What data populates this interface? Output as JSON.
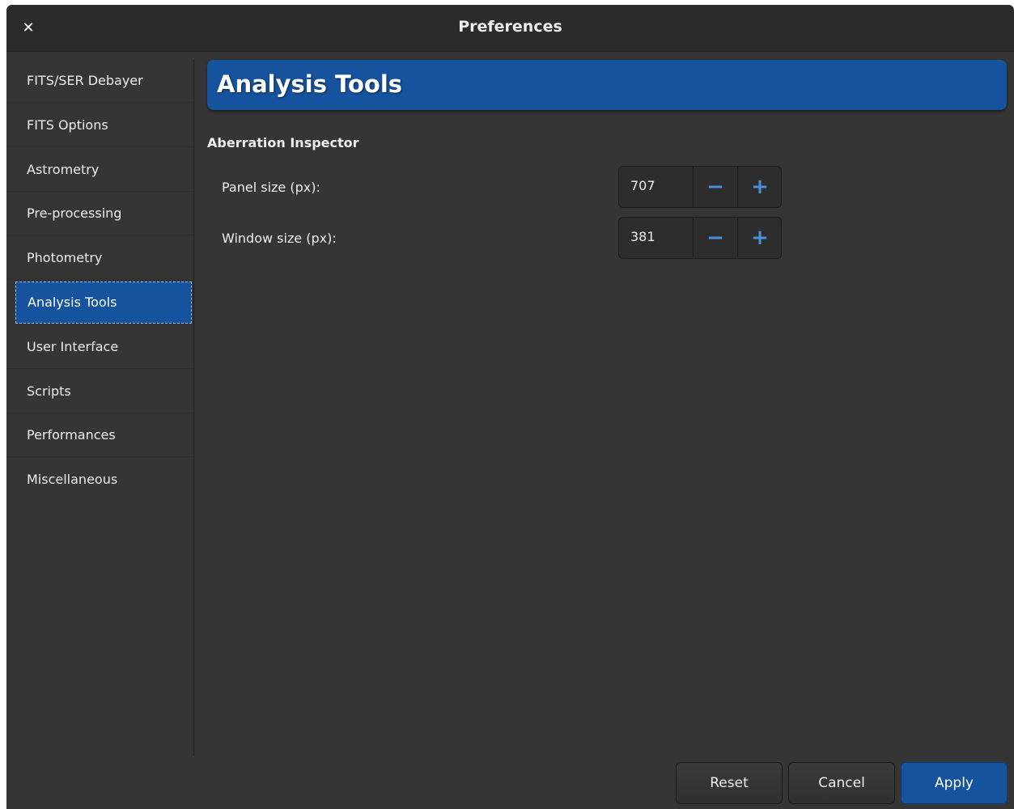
{
  "window": {
    "title": "Preferences",
    "close_icon": "close-icon"
  },
  "sidebar": {
    "items": [
      {
        "label": "FITS/SER Debayer"
      },
      {
        "label": "FITS Options"
      },
      {
        "label": "Astrometry"
      },
      {
        "label": "Pre-processing"
      },
      {
        "label": "Photometry"
      },
      {
        "label": "Analysis Tools",
        "selected": true
      },
      {
        "label": "User Interface"
      },
      {
        "label": "Scripts"
      },
      {
        "label": "Performances"
      },
      {
        "label": "Miscellaneous"
      }
    ]
  },
  "page": {
    "header": "Analysis Tools",
    "section": "Aberration Inspector",
    "fields": [
      {
        "label": "Panel size (px):",
        "value": "707"
      },
      {
        "label": "Window size (px):",
        "value": "381"
      }
    ],
    "minus_glyph": "−",
    "plus_glyph": "+"
  },
  "buttons": {
    "reset": "Reset",
    "cancel": "Cancel",
    "apply": "Apply"
  },
  "colors": {
    "accent": "#15539e",
    "background": "#353535",
    "titlebar": "#2b2b2b",
    "spin_icon": "#4a90d9"
  }
}
